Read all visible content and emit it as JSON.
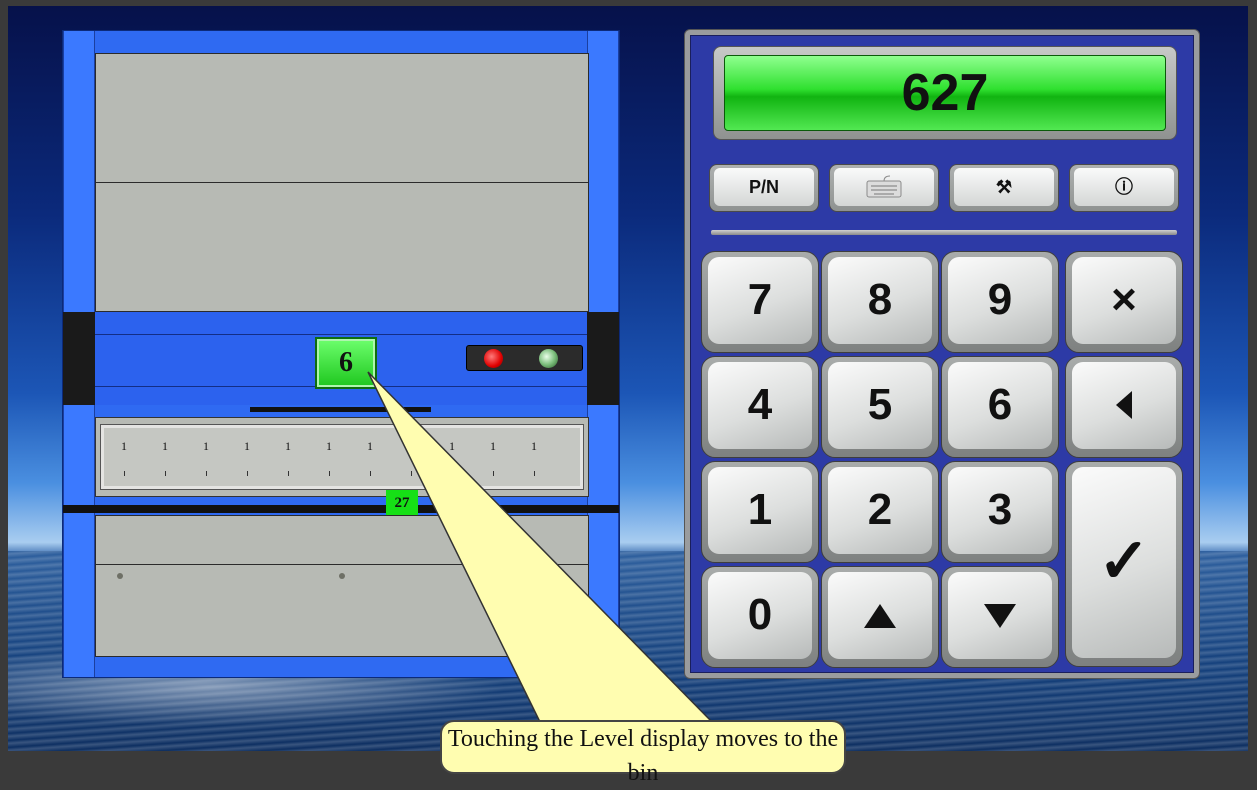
{
  "cabinet": {
    "shelf_button_label": "6",
    "position_label": "27",
    "tray_ticks": [
      "1",
      "1",
      "1",
      "1",
      "1",
      "1",
      "1",
      "1",
      "1",
      "1",
      "1"
    ]
  },
  "keypad": {
    "display_value": "627",
    "function_buttons": [
      {
        "label": "P/N",
        "icon": "text-label"
      },
      {
        "label": "",
        "icon": "keyboard-icon"
      },
      {
        "label": "⚒",
        "icon": "tools-icon"
      },
      {
        "label": "ⓘ",
        "icon": "info-icon"
      }
    ],
    "keys": {
      "k7": "7",
      "k8": "8",
      "k9": "9",
      "clear": "×",
      "k4": "4",
      "k5": "5",
      "k6": "6",
      "back": "◀",
      "k1": "1",
      "k2": "2",
      "k3": "3",
      "enter": "✓",
      "k0": "0",
      "up": "▲",
      "down": "▼"
    }
  },
  "callout": {
    "text": "Touching the Level display moves to the bin"
  },
  "colors": {
    "cabinet_blue": "#2f6af2",
    "keypad_blue": "#2d3aa6",
    "display_green": "#2fe02f",
    "callout_yellow": "#fffdb0"
  }
}
